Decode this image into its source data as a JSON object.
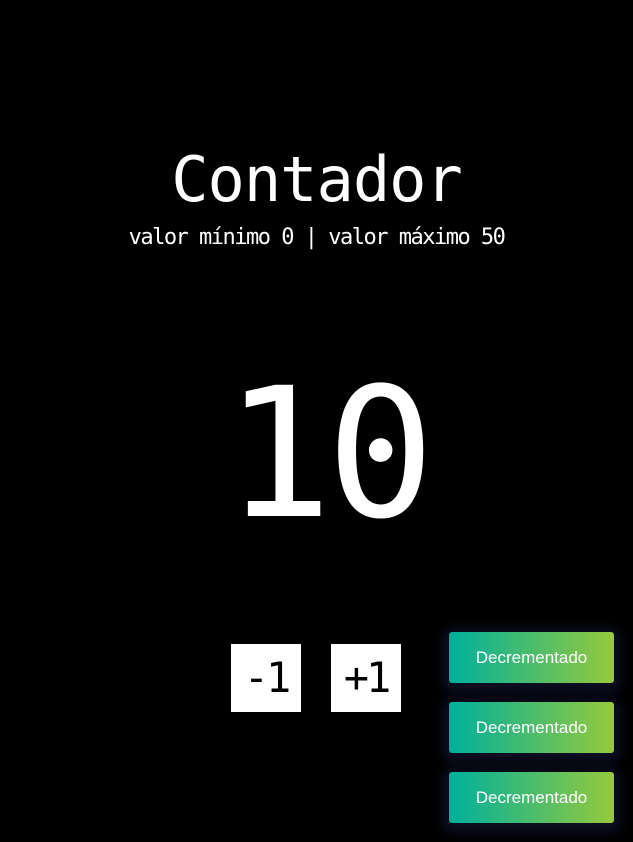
{
  "header": {
    "title": "Contador",
    "subtitle": "valor mínimo 0 | valor máximo 50"
  },
  "counter": {
    "value": "10"
  },
  "controls": {
    "decrement_label": "-1",
    "increment_label": "+1"
  },
  "toasts": [
    {
      "message": "Decrementado"
    },
    {
      "message": "Decrementado"
    },
    {
      "message": "Decrementado"
    }
  ],
  "colors": {
    "background": "#000000",
    "text": "#ffffff",
    "toast_gradient_start": "#00b09b",
    "toast_gradient_end": "#96c93d"
  }
}
